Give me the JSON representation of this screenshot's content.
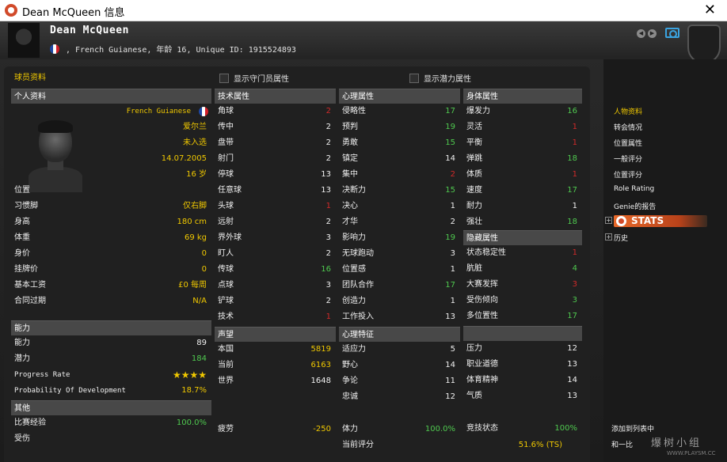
{
  "window": {
    "title": "Dean McQueen 信息"
  },
  "header": {
    "name": "Dean McQueen",
    "subline": ", French Guianese, 年龄 16, Unique ID: 1915524893"
  },
  "panel": {
    "title": "球员资料",
    "option_gk": "显示守门员属性",
    "option_potential": "显示潜力属性"
  },
  "personal": {
    "header": "个人资料",
    "nationality": "French Guianese",
    "club": "爱尔兰",
    "status": "未入选",
    "dob": "14.07.2005",
    "age": "16 岁",
    "rows": [
      {
        "label": "位置",
        "value": ""
      },
      {
        "label": "习惯脚",
        "value": "仅右脚"
      },
      {
        "label": "身高",
        "value": "180 cm"
      },
      {
        "label": "体重",
        "value": "69 kg"
      },
      {
        "label": "身价",
        "value": "0"
      },
      {
        "label": "挂牌价",
        "value": "0"
      },
      {
        "label": "基本工资",
        "value": "£0 每周"
      },
      {
        "label": "合同过期",
        "value": "N/A"
      }
    ]
  },
  "ability": {
    "header": "能力",
    "rows": [
      {
        "label": "能力",
        "value": "89"
      },
      {
        "label": "潜力",
        "value": "184"
      },
      {
        "label": "Progress Rate",
        "value": "★★★★"
      },
      {
        "label": "Probability Of Development",
        "value": "18.7%"
      }
    ]
  },
  "other": {
    "header": "其他",
    "rows": [
      {
        "label": "比赛经验",
        "value": "100.0%"
      },
      {
        "label": "受伤",
        "value": ""
      }
    ]
  },
  "technical": {
    "header": "技术属性",
    "rows": [
      {
        "label": "角球",
        "value": "2"
      },
      {
        "label": "传中",
        "value": "2"
      },
      {
        "label": "盘带",
        "value": "2"
      },
      {
        "label": "射门",
        "value": "2"
      },
      {
        "label": "停球",
        "value": "13"
      },
      {
        "label": "任意球",
        "value": "13"
      },
      {
        "label": "头球",
        "value": "1"
      },
      {
        "label": "远射",
        "value": "2"
      },
      {
        "label": "界外球",
        "value": "3"
      },
      {
        "label": "盯人",
        "value": "2"
      },
      {
        "label": "传球",
        "value": "16"
      },
      {
        "label": "点球",
        "value": "3"
      },
      {
        "label": "铲球",
        "value": "2"
      },
      {
        "label": "技术",
        "value": "1"
      }
    ]
  },
  "reputation": {
    "header": "声望",
    "rows": [
      {
        "label": "本国",
        "value": "5819"
      },
      {
        "label": "当前",
        "value": "6163"
      },
      {
        "label": "世界",
        "value": "1648"
      }
    ]
  },
  "fatigue": {
    "label": "疲劳",
    "value": "-250"
  },
  "mental": {
    "header": "心理属性",
    "rows": [
      {
        "label": "侵略性",
        "value": "17"
      },
      {
        "label": "预判",
        "value": "19"
      },
      {
        "label": "勇敢",
        "value": "15"
      },
      {
        "label": "镇定",
        "value": "14"
      },
      {
        "label": "集中",
        "value": "2"
      },
      {
        "label": "决断力",
        "value": "15"
      },
      {
        "label": "决心",
        "value": "1"
      },
      {
        "label": "才华",
        "value": "2"
      },
      {
        "label": "影响力",
        "value": "19"
      },
      {
        "label": "无球跑动",
        "value": "3"
      },
      {
        "label": "位置感",
        "value": "1"
      },
      {
        "label": "团队合作",
        "value": "17"
      },
      {
        "label": "创造力",
        "value": "1"
      },
      {
        "label": "工作投入",
        "value": "13"
      }
    ]
  },
  "traits": {
    "header": "心理特征",
    "rows": [
      {
        "label": "适应力",
        "value": "5"
      },
      {
        "label": "野心",
        "value": "14"
      },
      {
        "label": "争论",
        "value": "11"
      },
      {
        "label": "忠诚",
        "value": "12"
      }
    ]
  },
  "condition": {
    "label": "体力",
    "value": "100.0%"
  },
  "rating": {
    "label": "当前评分",
    "value": "51.6% (TS)"
  },
  "physical": {
    "header": "身体属性",
    "rows": [
      {
        "label": "爆发力",
        "value": "16"
      },
      {
        "label": "灵活",
        "value": "1"
      },
      {
        "label": "平衡",
        "value": "1"
      },
      {
        "label": "弹跳",
        "value": "18"
      },
      {
        "label": "体质",
        "value": "1"
      },
      {
        "label": "速度",
        "value": "17"
      },
      {
        "label": "耐力",
        "value": "1"
      },
      {
        "label": "强壮",
        "value": "18"
      }
    ]
  },
  "hidden": {
    "header": "隐藏属性",
    "rows": [
      {
        "label": "状态稳定性",
        "value": "1"
      },
      {
        "label": "肮脏",
        "value": "4"
      },
      {
        "label": "大赛发挥",
        "value": "3"
      },
      {
        "label": "受伤倾向",
        "value": "3"
      },
      {
        "label": "多位置性",
        "value": "17"
      }
    ]
  },
  "personality": {
    "rows": [
      {
        "label": "压力",
        "value": "12"
      },
      {
        "label": "职业道德",
        "value": "13"
      },
      {
        "label": "体育精神",
        "value": "14"
      },
      {
        "label": "气质",
        "value": "13"
      }
    ]
  },
  "match_status": {
    "label": "竞技状态",
    "value": "100%"
  },
  "sidebar": {
    "items": [
      "人物资料",
      "转会情况",
      "位置属性",
      "一般评分",
      "位置评分",
      "Role Rating",
      "Genie的报告"
    ],
    "stats_label": "STATS",
    "history": "历史",
    "add_to_list": "添加到列表中",
    "bottom_partial": "和一比"
  },
  "watermark": {
    "text": "爆树小组",
    "sub": "WWW.PLAYSM.CC"
  }
}
